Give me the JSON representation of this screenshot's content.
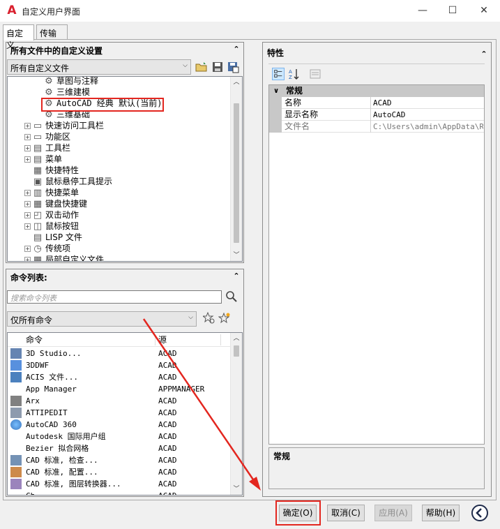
{
  "window": {
    "title": "自定义用户界面",
    "minimize_glyph": "—",
    "maximize_glyph": "☐",
    "close_glyph": "✕"
  },
  "tabs": [
    {
      "label": "自定义",
      "active": true
    },
    {
      "label": "传输",
      "active": false
    }
  ],
  "customize_panel": {
    "header": "所有文件中的自定义设置",
    "file_filter": "所有自定义文件",
    "tree": [
      {
        "label": "草图与注释",
        "icon": "gear-icon",
        "expander": "",
        "level": 2
      },
      {
        "label": "三维建模",
        "icon": "gear-icon",
        "expander": "",
        "level": 2
      },
      {
        "label": "AutoCAD 经典 默认(当前)",
        "icon": "gear-icon",
        "expander": "",
        "level": 2,
        "highlighted": true
      },
      {
        "label": "三维基础",
        "icon": "gear-icon",
        "expander": "",
        "level": 2
      },
      {
        "label": "快速访问工具栏",
        "icon": "quick-access-toolbar-icon",
        "expander": "+",
        "level": 1
      },
      {
        "label": "功能区",
        "icon": "ribbon-icon",
        "expander": "+",
        "level": 1
      },
      {
        "label": "工具栏",
        "icon": "toolbar-icon",
        "expander": "+",
        "level": 1
      },
      {
        "label": "菜单",
        "icon": "menu-icon",
        "expander": "+",
        "level": 1
      },
      {
        "label": "快捷特性",
        "icon": "quick-properties-icon",
        "expander": "",
        "level": 1
      },
      {
        "label": "鼠标悬停工具提示",
        "icon": "rollover-tooltip-icon",
        "expander": "",
        "level": 1
      },
      {
        "label": "快捷菜单",
        "icon": "shortcut-menu-icon",
        "expander": "+",
        "level": 1
      },
      {
        "label": "键盘快捷键",
        "icon": "keyboard-shortcut-icon",
        "expander": "+",
        "level": 1
      },
      {
        "label": "双击动作",
        "icon": "double-click-icon",
        "expander": "+",
        "level": 1
      },
      {
        "label": "鼠标按钮",
        "icon": "mouse-button-icon",
        "expander": "+",
        "level": 1
      },
      {
        "label": "LISP 文件",
        "icon": "lisp-file-icon",
        "expander": "",
        "level": 1
      },
      {
        "label": "传统项",
        "icon": "legacy-icon",
        "expander": "+",
        "level": 1
      },
      {
        "label": "局部自定义文件",
        "icon": "partial-file-icon",
        "expander": "+",
        "level": 1
      }
    ]
  },
  "commands_panel": {
    "header": "命令列表:",
    "search_placeholder": "搜索命令列表",
    "filter": "仅所有命令",
    "columns": {
      "command": "命令",
      "source": "源"
    },
    "rows": [
      {
        "name": "3D Studio...",
        "source": "ACAD",
        "icon": "3ds-icon"
      },
      {
        "name": "3DDWF",
        "source": "ACAD",
        "icon": "3ddwf-icon"
      },
      {
        "name": "ACIS 文件...",
        "source": "ACAD",
        "icon": "acis-icon"
      },
      {
        "name": "App Manager",
        "source": "APPMANAGER",
        "icon": ""
      },
      {
        "name": "Arx",
        "source": "ACAD",
        "icon": "arx-icon"
      },
      {
        "name": "ATTIPEDIT",
        "source": "ACAD",
        "icon": "attipedit-icon"
      },
      {
        "name": "AutoCAD 360",
        "source": "ACAD",
        "icon": "autocad-360-icon"
      },
      {
        "name": "Autodesk 国际用户组",
        "source": "ACAD",
        "icon": ""
      },
      {
        "name": "Bezier 拟合网格",
        "source": "ACAD",
        "icon": ""
      },
      {
        "name": "CAD 标准, 检查...",
        "source": "ACAD",
        "icon": "cad-standards-check-icon"
      },
      {
        "name": "CAD 标准, 配置...",
        "source": "ACAD",
        "icon": "cad-standards-configure-icon"
      },
      {
        "name": "CAD 标准, 图层转换器...",
        "source": "ACAD",
        "icon": "layer-translator-icon"
      },
      {
        "name": "Ch...",
        "source": "ACAD",
        "icon": ""
      }
    ]
  },
  "properties_panel": {
    "header": "特性",
    "category": "常规",
    "rows": [
      {
        "key": "名称",
        "value": "ACAD"
      },
      {
        "key": "显示名称",
        "value": "AutoCAD"
      },
      {
        "key": "文件名",
        "value": "C:\\Users\\admin\\AppData\\Roaming"
      }
    ],
    "description_title": "常规"
  },
  "buttons": {
    "ok": "确定(O)",
    "cancel": "取消(C)",
    "apply": "应用(A)",
    "help": "帮助(H)"
  },
  "colors": {
    "highlight": "#e3261f",
    "arrow": "#e3261f",
    "selection": "#cce8ff"
  }
}
